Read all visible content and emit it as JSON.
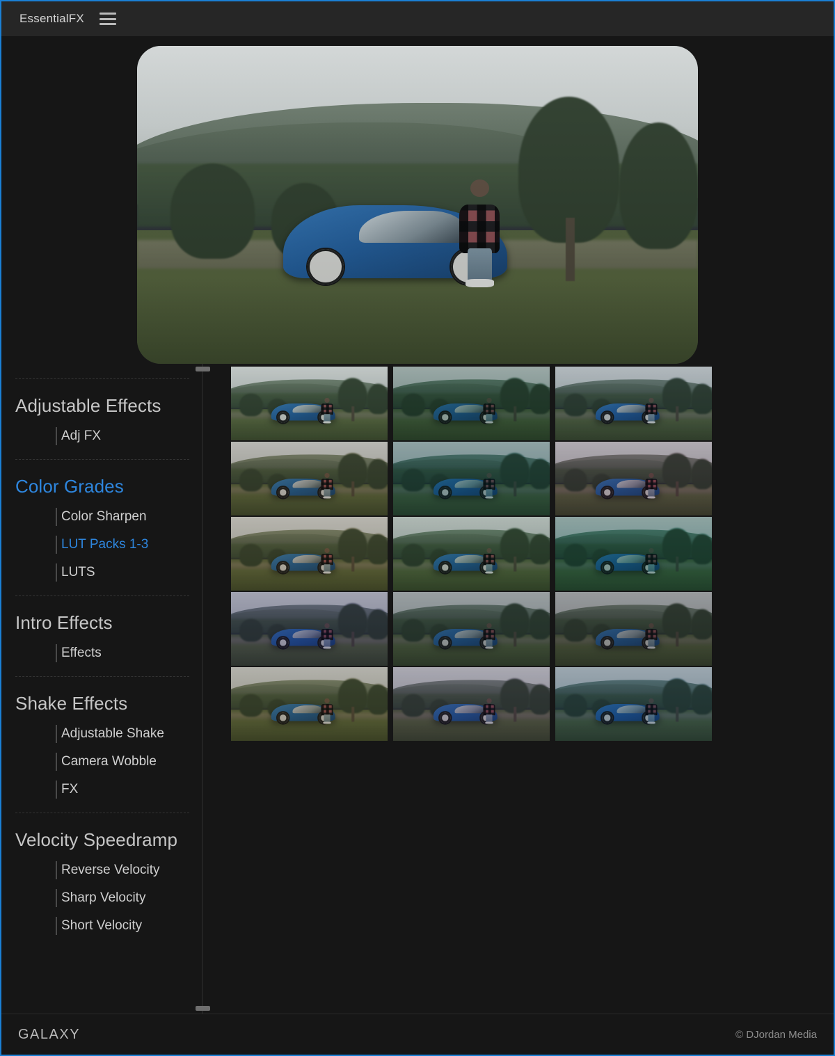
{
  "window": {
    "accent_border_color": "#1a7fd4",
    "background": "#141414"
  },
  "titlebar": {
    "app_title": "EssentialFX",
    "menu_icon": "hamburger-icon"
  },
  "preview": {
    "alt": "Blue Subaru WRX parked on grass field with person in plaid shirt walking, mountains in background"
  },
  "sidebar": {
    "groups": [
      {
        "label": "Adjustable Effects",
        "active": false,
        "items": [
          {
            "label": "Adj FX",
            "selected": false
          }
        ]
      },
      {
        "label": "Color Grades",
        "active": true,
        "items": [
          {
            "label": "Color Sharpen",
            "selected": false
          },
          {
            "label": "LUT Packs 1-3",
            "selected": true
          },
          {
            "label": "LUTS",
            "selected": false
          }
        ]
      },
      {
        "label": "Intro Effects",
        "active": false,
        "items": [
          {
            "label": "Effects",
            "selected": false
          }
        ]
      },
      {
        "label": "Shake Effects",
        "active": false,
        "items": [
          {
            "label": "Adjustable Shake",
            "selected": false
          },
          {
            "label": "Camera Wobble",
            "selected": false
          },
          {
            "label": "FX",
            "selected": false
          }
        ]
      },
      {
        "label": "Velocity Speedramp",
        "active": false,
        "items": [
          {
            "label": "Reverse Velocity",
            "selected": false
          },
          {
            "label": "Sharp Velocity",
            "selected": false
          },
          {
            "label": "Short Velocity",
            "selected": false
          }
        ]
      }
    ],
    "selected_item_color": "#2e86de",
    "header_color": "#c6c6c6"
  },
  "grid": {
    "columns": 3,
    "rows": 5,
    "count": 15,
    "thumbnails": [
      {
        "name": "lut-preset-1",
        "tint": "rgba(150,170,150,0.18)",
        "tone": "rgba(30,40,35,0.10)"
      },
      {
        "name": "lut-preset-2",
        "tint": "rgba(70,140,120,0.30)",
        "tone": "rgba(10,35,30,0.26)"
      },
      {
        "name": "lut-preset-3",
        "tint": "rgba(120,150,170,0.20)",
        "tone": "rgba(15,25,45,0.16)"
      },
      {
        "name": "lut-preset-4",
        "tint": "rgba(190,165,120,0.26)",
        "tone": "rgba(40,30,20,0.18)"
      },
      {
        "name": "lut-preset-5",
        "tint": "rgba(60,150,160,0.32)",
        "tone": "rgba(8,35,40,0.30)"
      },
      {
        "name": "lut-preset-6",
        "tint": "rgba(180,130,150,0.28)",
        "tone": "rgba(35,18,40,0.22)"
      },
      {
        "name": "lut-preset-7",
        "tint": "rgba(200,170,120,0.30)",
        "tone": "rgba(45,35,20,0.20)"
      },
      {
        "name": "lut-preset-8",
        "tint": "rgba(120,170,130,0.22)",
        "tone": "rgba(18,32,22,0.18)"
      },
      {
        "name": "lut-preset-9",
        "tint": "rgba(40,160,150,0.34)",
        "tone": "rgba(5,40,38,0.30)"
      },
      {
        "name": "lut-preset-10",
        "tint": "rgba(130,120,200,0.26)",
        "tone": "rgba(22,20,55,0.26)"
      },
      {
        "name": "lut-preset-11",
        "tint": "rgba(130,155,165,0.20)",
        "tone": "rgba(20,28,34,0.30)"
      },
      {
        "name": "lut-preset-12",
        "tint": "rgba(150,150,155,0.18)",
        "tone": "rgba(25,26,30,0.32)"
      },
      {
        "name": "lut-preset-13",
        "tint": "rgba(200,180,130,0.28)",
        "tone": "rgba(40,34,20,0.22)"
      },
      {
        "name": "lut-preset-14",
        "tint": "rgba(170,140,190,0.26)",
        "tone": "rgba(30,22,48,0.24)"
      },
      {
        "name": "lut-preset-15",
        "tint": "rgba(90,150,190,0.30)",
        "tone": "rgba(12,28,50,0.26)"
      }
    ]
  },
  "footer": {
    "brand": "GALAXY",
    "copyright": "© DJordan Media"
  }
}
